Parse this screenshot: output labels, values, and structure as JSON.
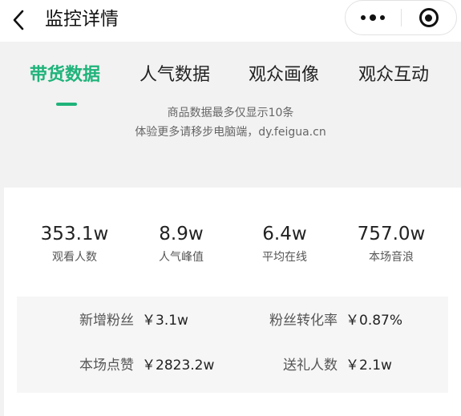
{
  "nav": {
    "title": "监控详情",
    "back_icon": "chevron-left-icon",
    "menu_icon": "more-dots-icon",
    "close_icon": "target-circle-icon"
  },
  "tabs": [
    {
      "label": "带货数据",
      "active": true
    },
    {
      "label": "人气数据",
      "active": false
    },
    {
      "label": "观众画像",
      "active": false
    },
    {
      "label": "观众互动",
      "active": false
    }
  ],
  "notice": {
    "line1": "商品数据最多仅显示10条",
    "line2": "体验更多请移步电脑端，dy.feigua.cn"
  },
  "stats": [
    {
      "value": "353.1w",
      "label": "观看人数"
    },
    {
      "value": "8.9w",
      "label": "人气峰值"
    },
    {
      "value": "6.4w",
      "label": "平均在线"
    },
    {
      "value": "757.0w",
      "label": "本场音浪"
    }
  ],
  "metrics": [
    {
      "label": "新增粉丝",
      "value": "￥3.1w"
    },
    {
      "label": "粉丝转化率",
      "value": "￥0.87%"
    },
    {
      "label": "本场点赞",
      "value": "￥2823.2w"
    },
    {
      "label": "送礼人数",
      "value": "￥2.1w"
    }
  ],
  "colors": {
    "accent": "#1fb37a",
    "background": "#f2f2f2",
    "card": "#ffffff",
    "metrics_panel": "#f6f6f6"
  }
}
